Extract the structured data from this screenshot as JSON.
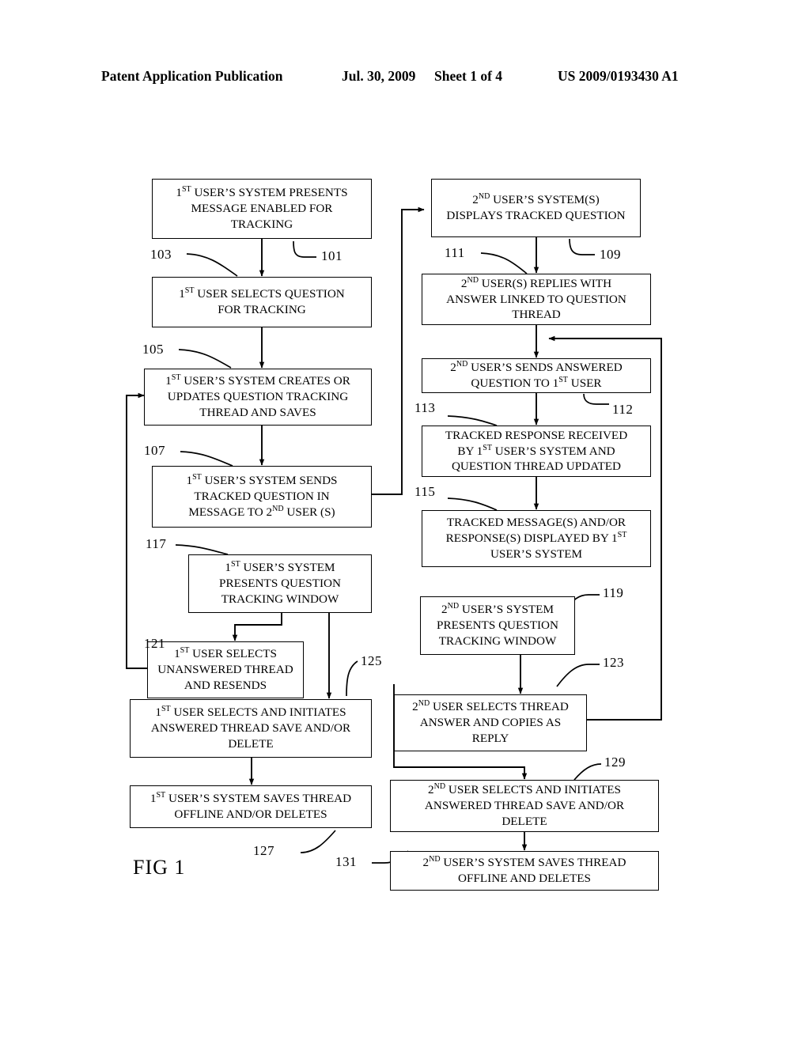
{
  "header": {
    "publication": "Patent Application Publication",
    "date": "Jul. 30, 2009",
    "sheet": "Sheet 1 of 4",
    "patent_number": "US 2009/0193430 A1"
  },
  "figure": {
    "caption": "FIG 1"
  },
  "nodes": [
    {
      "id": "101",
      "text": "1<sup>ST</sup> USER’S SYSTEM PRESENTS\nMESSAGE ENABLED FOR\nTRACKING"
    },
    {
      "id": "103",
      "text": "1<sup>ST</sup> USER SELECTS QUESTION\nFOR TRACKING"
    },
    {
      "id": "105",
      "text": "1<sup>ST</sup> USER’S SYSTEM CREATES OR\nUPDATES QUESTION TRACKING\nTHREAD AND SAVES"
    },
    {
      "id": "107",
      "text": "1<sup>ST</sup> USER’S SYSTEM SENDS\nTRACKED QUESTION IN\nMESSAGE TO 2<sup>ND</sup> USER (S)"
    },
    {
      "id": "117",
      "text": "1<sup>ST</sup> USER’S SYSTEM\nPRESENTS QUESTION\nTRACKING WINDOW"
    },
    {
      "id": "121",
      "text": "1<sup>ST</sup> USER SELECTS\nUNANSWERED THREAD\nAND RESENDS"
    },
    {
      "id": "125",
      "text": "1<sup>ST</sup> USER SELECTS AND INITIATES\nANSWERED THREAD SAVE AND/OR\nDELETE"
    },
    {
      "id": "127",
      "text": "1<sup>ST</sup> USER’S SYSTEM SAVES THREAD\nOFFLINE AND/OR DELETES"
    },
    {
      "id": "109",
      "text": "2<sup>ND</sup> USER’S SYSTEM(S)\nDISPLAYS TRACKED QUESTION"
    },
    {
      "id": "111",
      "text": "2<sup>ND</sup> USER(S) REPLIES WITH\nANSWER LINKED TO QUESTION\nTHREAD"
    },
    {
      "id": "112",
      "text": "2<sup>ND</sup> USER’S SENDS ANSWERED\nQUESTION TO 1<sup>ST</sup> USER"
    },
    {
      "id": "113",
      "text": "TRACKED RESPONSE RECEIVED\nBY 1<sup>ST</sup> USER’S SYSTEM AND\nQUESTION THREAD UPDATED"
    },
    {
      "id": "115",
      "text": "TRACKED MESSAGE(S) AND/OR\nRESPONSE(S)  DISPLAYED BY 1<sup>ST</sup>\nUSER’S SYSTEM"
    },
    {
      "id": "119",
      "text": "2<sup>ND</sup> USER’S SYSTEM\nPRESENTS QUESTION\nTRACKING WINDOW"
    },
    {
      "id": "123",
      "text": "2<sup>ND</sup> USER SELECTS THREAD\nANSWER AND COPIES AS\nREPLY"
    },
    {
      "id": "129",
      "text": "2<sup>ND</sup> USER SELECTS AND INITIATES\nANSWERED THREAD SAVE AND/OR\nDELETE"
    },
    {
      "id": "131",
      "text": "2<sup>ND</sup> USER’S SYSTEM SAVES THREAD\nOFFLINE AND DELETES"
    }
  ],
  "reference_labels": [
    {
      "id": "101",
      "label": "101"
    },
    {
      "id": "103",
      "label": "103"
    },
    {
      "id": "105",
      "label": "105"
    },
    {
      "id": "107",
      "label": "107"
    },
    {
      "id": "109",
      "label": "109"
    },
    {
      "id": "111",
      "label": "111"
    },
    {
      "id": "112",
      "label": "112"
    },
    {
      "id": "113",
      "label": "113"
    },
    {
      "id": "115",
      "label": "115"
    },
    {
      "id": "117",
      "label": "117"
    },
    {
      "id": "119",
      "label": "119"
    },
    {
      "id": "121",
      "label": "121"
    },
    {
      "id": "123",
      "label": "123"
    },
    {
      "id": "125",
      "label": "125"
    },
    {
      "id": "127",
      "label": "127"
    },
    {
      "id": "129",
      "label": "129"
    },
    {
      "id": "131",
      "label": "131"
    }
  ]
}
